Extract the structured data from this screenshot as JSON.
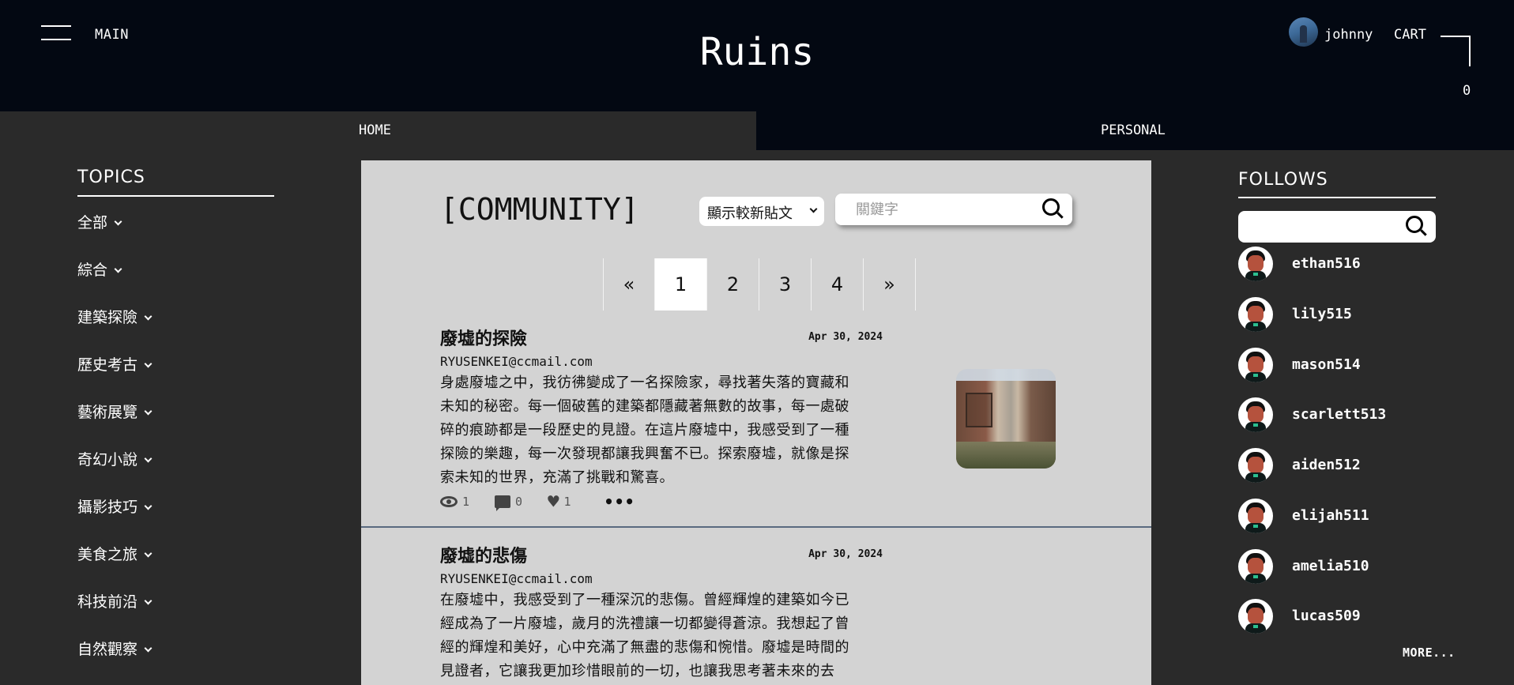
{
  "header": {
    "menu_label": "MAIN",
    "site_title": "Ruins",
    "username": "johnny",
    "cart_label": "CART",
    "cart_count": "0"
  },
  "nav": {
    "home": "HOME",
    "personal": "PERSONAL"
  },
  "topics": {
    "title": "TOPICS",
    "items": [
      "全部",
      "綜合",
      "建築探險",
      "歷史考古",
      "藝術展覽",
      "奇幻小說",
      "攝影技巧",
      "美食之旅",
      "科技前沿",
      "自然觀察"
    ]
  },
  "community": {
    "title": "[COMMUNITY]",
    "sort_selected": "顯示較新貼文",
    "search_placeholder": "關鍵字",
    "pagination": {
      "prev": "«",
      "pages": [
        "1",
        "2",
        "3",
        "4"
      ],
      "next": "»",
      "active": "1"
    }
  },
  "posts": [
    {
      "title": "廢墟的探險",
      "date": "Apr 30, 2024",
      "author": "RYUSENKEI@ccmail.com",
      "body_lines": [
        "身處廢墟之中，我彷彿變成了一名探險家，尋找著失落的寶藏和",
        "未知的秘密。每一個破舊的建築都隱藏著無數的故事，每一處破",
        "碎的痕跡都是一段歷史的見證。在這片廢墟中，我感受到了一種",
        "探險的樂趣，每一次發現都讓我興奮不已。探索廢墟，就像是探",
        "索未知的世界，充滿了挑戰和驚喜。"
      ],
      "views": "1",
      "comments": "0",
      "likes": "1",
      "more": "•••"
    },
    {
      "title": "廢墟的悲傷",
      "date": "Apr 30, 2024",
      "author": "RYUSENKEI@ccmail.com",
      "body_lines": [
        "在廢墟中，我感受到了一種深沉的悲傷。曾經輝煌的建築如今已",
        "經成為了一片廢墟，歲月的洗禮讓一切都變得蒼涼。我想起了曾",
        "經的輝煌和美好，心中充滿了無盡的悲傷和惋惜。廢墟是時間的",
        "見證者，它讓我更加珍惜眼前的一切，也讓我思考著未來的去"
      ]
    }
  ],
  "follows": {
    "title": "FOLLOWS",
    "search_placeholder": "",
    "users": [
      "ethan516",
      "lily515",
      "mason514",
      "scarlett513",
      "aiden512",
      "elijah511",
      "amelia510",
      "lucas509"
    ],
    "more_label": "MORE..."
  }
}
